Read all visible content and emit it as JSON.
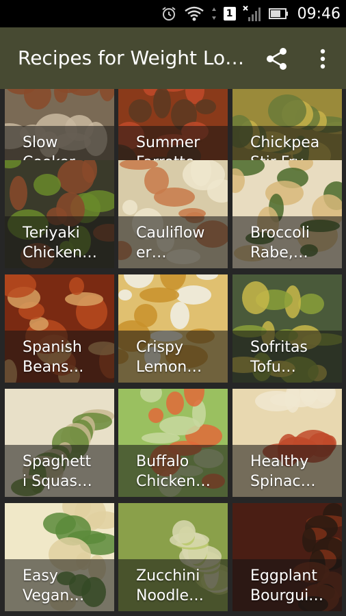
{
  "status_bar": {
    "time": "09:46",
    "sim_label": "1",
    "icons": [
      "alarm-icon",
      "wifi-icon",
      "sim-icon",
      "no-signal-icon",
      "battery-icon"
    ]
  },
  "app_bar": {
    "title": "Recipes for Weight Lo…",
    "actions": [
      "share-icon",
      "more-vert-icon"
    ],
    "color": "#474a32"
  },
  "recipes": [
    {
      "label": "Slow\nCooker…",
      "colors": [
        "#7a6a55",
        "#c9b8a0",
        "#8a4a2a"
      ]
    },
    {
      "label": "Summer\nFarrotto",
      "colors": [
        "#8a3a1a",
        "#c04a2a",
        "#5a3a22"
      ]
    },
    {
      "label": "Chickpea\nStir Fry",
      "colors": [
        "#9a8a3a",
        "#c8b24a",
        "#6a7a3a"
      ]
    },
    {
      "label": "Teriyaki\nChicken…",
      "colors": [
        "#3a3a2a",
        "#6a8a2a",
        "#8a4a2a"
      ]
    },
    {
      "label": "Cauliflow\ner…",
      "colors": [
        "#d8cba8",
        "#efe6cc",
        "#c87a4a"
      ]
    },
    {
      "label": "Broccoli\nRabe,…",
      "colors": [
        "#e8dcc0",
        "#d8b87a",
        "#4a6a2a"
      ]
    },
    {
      "label": "Spanish\nBeans…",
      "colors": [
        "#7a2a12",
        "#b84a1e",
        "#d8a060"
      ]
    },
    {
      "label": "Crispy\nLemon…",
      "colors": [
        "#e0c070",
        "#f0f0e8",
        "#c8902a"
      ]
    },
    {
      "label": "Sofritas\nTofu…",
      "colors": [
        "#4a5a3a",
        "#8aa03a",
        "#c8b84a"
      ]
    },
    {
      "label": "Spaghett\ni Squas…",
      "colors": [
        "#e8e0c8",
        "#c8b890",
        "#6a8a3a"
      ]
    },
    {
      "label": "Buffalo\nChicken…",
      "colors": [
        "#9ac060",
        "#e06a3a",
        "#c8d8a0"
      ]
    },
    {
      "label": "Healthy\nSpinac…",
      "colors": [
        "#e8d8b0",
        "#c04a2a",
        "#f0e8d0"
      ]
    },
    {
      "label": "Easy\nVegan…",
      "colors": [
        "#f0e8c8",
        "#e0d0a0",
        "#5a8a3a"
      ]
    },
    {
      "label": "Zucchini\nNoodle…",
      "colors": [
        "#8aa04a",
        "#b8c86a",
        "#d8d8b0"
      ]
    },
    {
      "label": "Eggplant\nBourgui…",
      "colors": [
        "#4a1e14",
        "#7a3018",
        "#2a1a10"
      ]
    }
  ]
}
